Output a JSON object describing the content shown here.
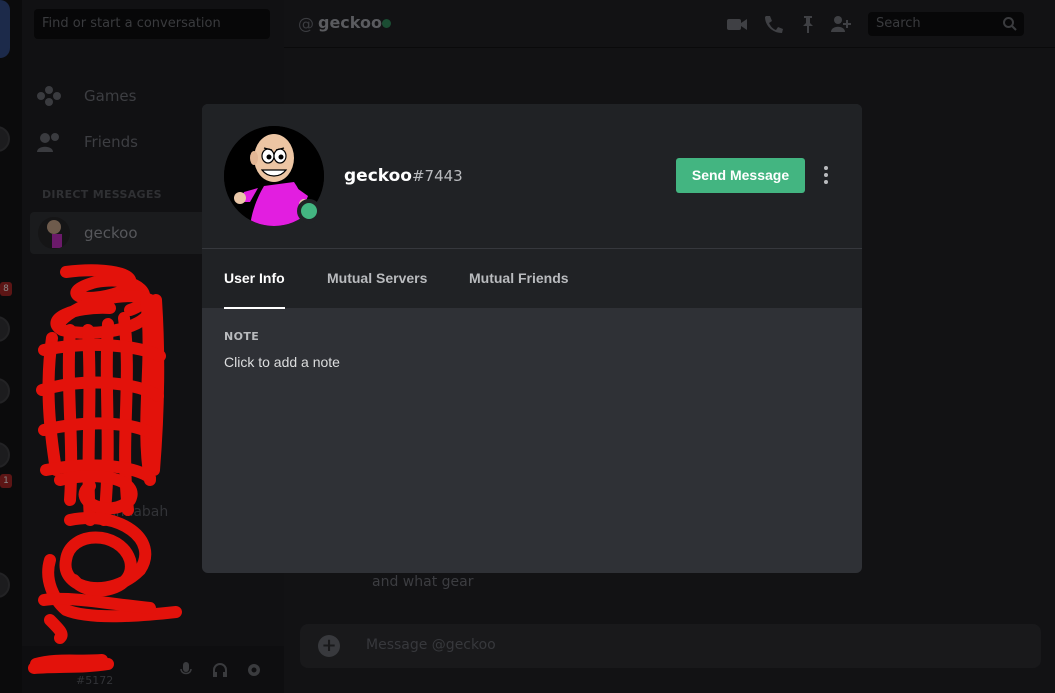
{
  "sidebar": {
    "search_placeholder": "Find or start a conversation",
    "nav": [
      {
        "label": "Games",
        "icon": "gamepad-icon"
      },
      {
        "label": "Friends",
        "icon": "friends-icon"
      }
    ],
    "section_title": "DIRECT MESSAGES",
    "dm_selected": "geckoo",
    "dm_faded_item": "Annabah",
    "user_tag": "#5172",
    "user_name_fragment": "pe"
  },
  "guild_badges": [
    "8",
    "1"
  ],
  "header": {
    "at_symbol": "@",
    "channel_name": "geckoo",
    "search_placeholder": "Search"
  },
  "chat": {
    "last_message": "and what gear",
    "composer_placeholder": "Message @geckoo"
  },
  "profile": {
    "username": "geckoo",
    "discriminator": "#7443",
    "status": "online",
    "send_message_label": "Send Message",
    "tabs": [
      "User Info",
      "Mutual Servers",
      "Mutual Friends"
    ],
    "active_tab": "User Info",
    "note_label": "NOTE",
    "note_placeholder": "Click to add a note"
  },
  "colors": {
    "accent_green": "#43b581",
    "modal_bg": "#2f3136",
    "header_bg": "#202225",
    "scribble_red": "#e3120b"
  }
}
